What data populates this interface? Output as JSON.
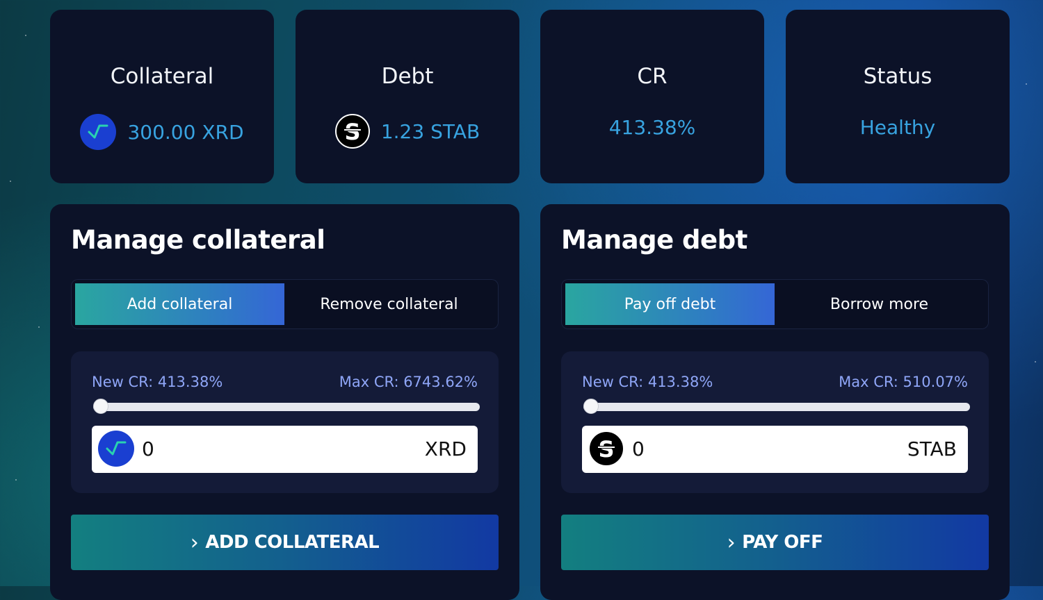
{
  "stats": {
    "collateral": {
      "title": "Collateral",
      "value": "300.00 XRD",
      "icon": "xrd-token-icon"
    },
    "debt": {
      "title": "Debt",
      "value": "1.23 STAB",
      "icon": "stab-token-icon"
    },
    "cr": {
      "title": "CR",
      "value": "413.38%"
    },
    "status": {
      "title": "Status",
      "value": "Healthy"
    }
  },
  "collateral_panel": {
    "title": "Manage collateral",
    "tabs": [
      "Add collateral",
      "Remove collateral"
    ],
    "active_tab": "Add collateral",
    "new_cr": "New CR: 413.38%",
    "max_cr": "Max CR: 6743.62%",
    "slider_value": 0,
    "amount": "0",
    "unit": "XRD",
    "button": "ADD COLLATERAL"
  },
  "debt_panel": {
    "title": "Manage debt",
    "tabs": [
      "Pay off debt",
      "Borrow more"
    ],
    "active_tab": "Pay off debt",
    "new_cr": "New CR: 413.38%",
    "max_cr": "Max CR: 510.07%",
    "slider_value": 0,
    "amount": "0",
    "unit": "STAB",
    "button": "PAY OFF"
  },
  "colors": {
    "card_bg": "#0c1228",
    "value_blue": "#38a3e0",
    "label_lavender": "#8fa6f7",
    "xrd_blue": "#1a3fd1"
  }
}
